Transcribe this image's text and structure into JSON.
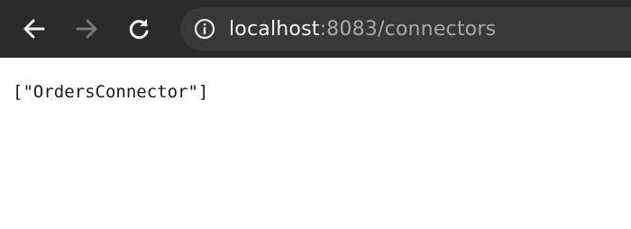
{
  "browser": {
    "toolbar": {
      "back_icon": "arrow-left-icon",
      "forward_icon": "arrow-right-icon",
      "reload_icon": "reload-icon"
    },
    "address_bar": {
      "info_icon": "info-icon",
      "host": "localhost",
      "rest": ":8083/connectors"
    }
  },
  "page": {
    "body_text": "[\"OrdersConnector\"]"
  },
  "colors": {
    "toolbar_bg": "#2b2b2b",
    "urlbar_bg": "#383838",
    "host_text": "#f2f2f2",
    "path_text": "#a8a8a8",
    "page_bg": "#ffffff"
  }
}
